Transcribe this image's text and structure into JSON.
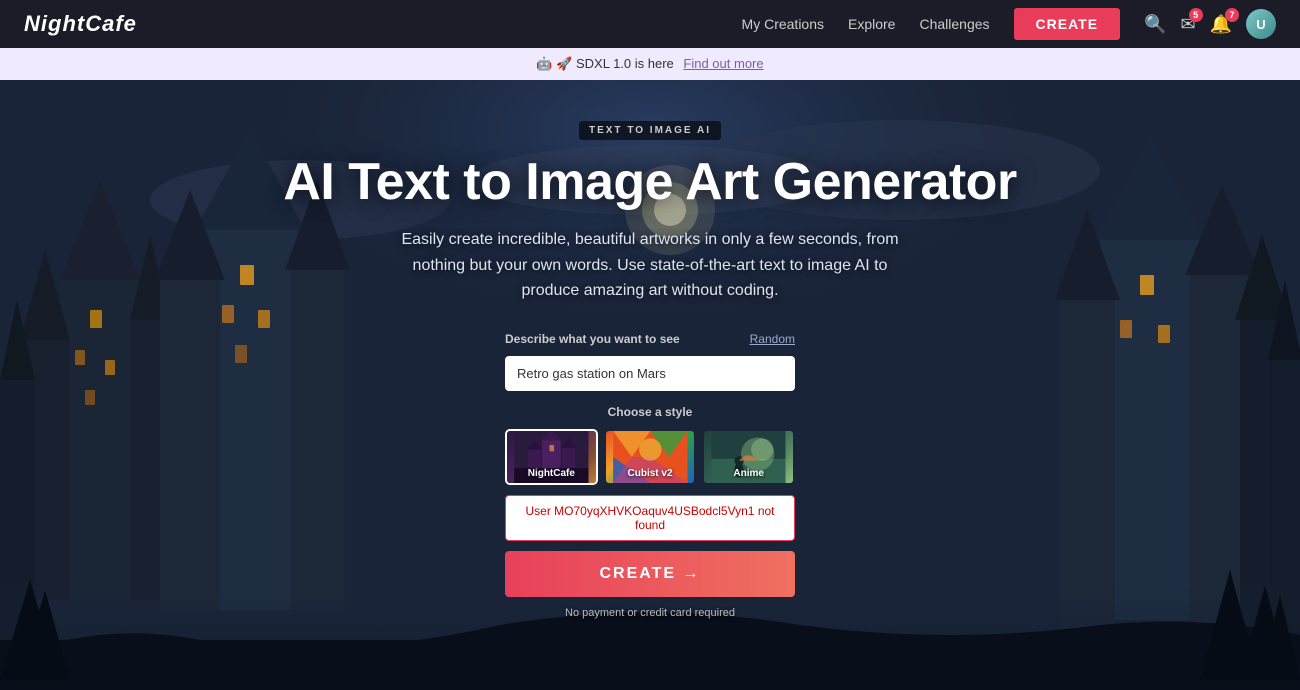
{
  "navbar": {
    "logo": "NightCafe",
    "links": [
      {
        "label": "My Creations",
        "name": "my-creations-link"
      },
      {
        "label": "Explore",
        "name": "explore-link"
      },
      {
        "label": "Challenges",
        "name": "challenges-link"
      }
    ],
    "create_label": "CREATE",
    "notification_badge": "7",
    "messages_badge": "5"
  },
  "announcement": {
    "text": "🤖 🚀 SDXL 1.0 is here",
    "link_text": "Find out more"
  },
  "hero": {
    "badge": "TEXT TO IMAGE AI",
    "title": "AI Text to Image Art Generator",
    "subtitle": "Easily create incredible, beautiful artworks in only a few seconds, from nothing but your own words. Use state-of-the-art text to image AI to produce amazing art without coding.",
    "form": {
      "describe_label": "Describe what you want to see",
      "random_label": "Random",
      "input_value": "Retro gas station on Mars",
      "style_label": "Choose a style",
      "styles": [
        {
          "name": "NightCafe",
          "selected": true
        },
        {
          "name": "Cubist v2",
          "selected": false
        },
        {
          "name": "Anime",
          "selected": false
        }
      ],
      "error_text": "User MO70yqXHVKOaquv4USBodcl5Vyn1 not found",
      "create_label": "CREATE →",
      "no_payment": "No payment or credit card required"
    }
  }
}
